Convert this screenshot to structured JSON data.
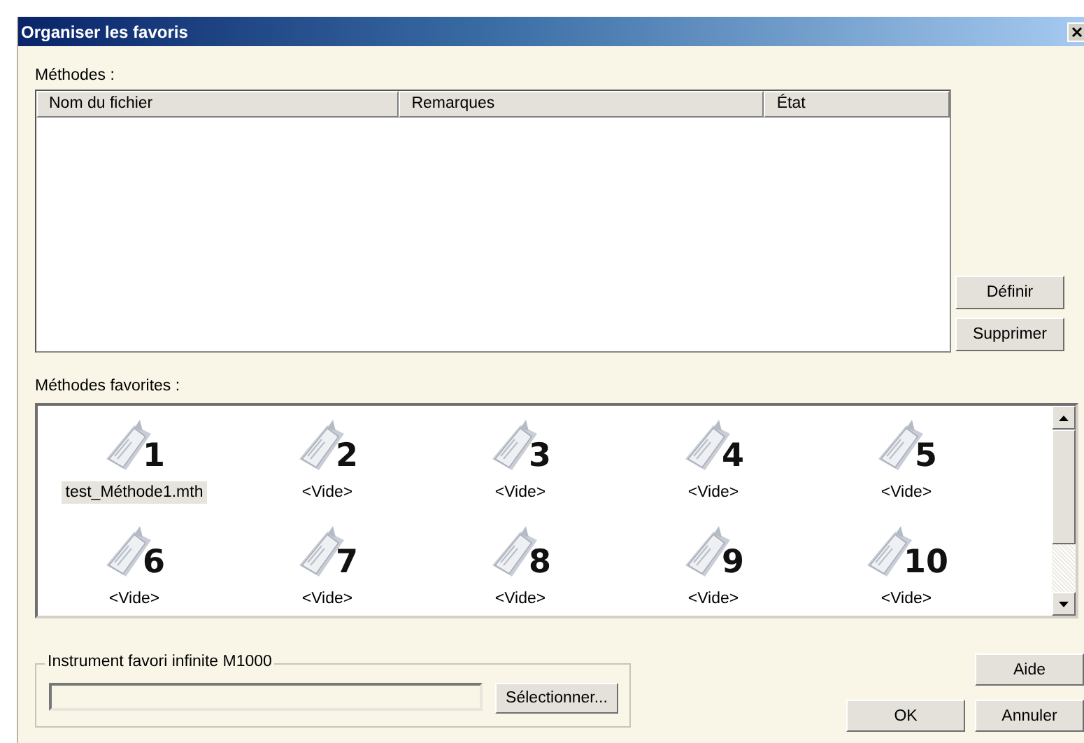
{
  "window": {
    "title": "Organiser les favoris"
  },
  "methods": {
    "label": "Méthodes :",
    "columns": [
      "Nom du fichier",
      "Remarques",
      "État"
    ]
  },
  "side_buttons": [
    "Définir",
    "Supprimer"
  ],
  "favorites": {
    "label": "Méthodes favorites :",
    "items": [
      {
        "number": "1",
        "name": "test_Méthode1.mth",
        "selected": true
      },
      {
        "number": "2",
        "name": "<Vide>",
        "selected": false
      },
      {
        "number": "3",
        "name": "<Vide>",
        "selected": false
      },
      {
        "number": "4",
        "name": "<Vide>",
        "selected": false
      },
      {
        "number": "5",
        "name": "<Vide>",
        "selected": false
      },
      {
        "number": "6",
        "name": "<Vide>",
        "selected": false
      },
      {
        "number": "7",
        "name": "<Vide>",
        "selected": false
      },
      {
        "number": "8",
        "name": "<Vide>",
        "selected": false
      },
      {
        "number": "9",
        "name": "<Vide>",
        "selected": false
      },
      {
        "number": "10",
        "name": "<Vide>",
        "selected": false
      }
    ]
  },
  "instrument": {
    "legend": "Instrument favori infinite M1000",
    "select_button": "Sélectionner..."
  },
  "buttons": {
    "help": "Aide",
    "ok": "OK",
    "cancel": "Annuler"
  }
}
